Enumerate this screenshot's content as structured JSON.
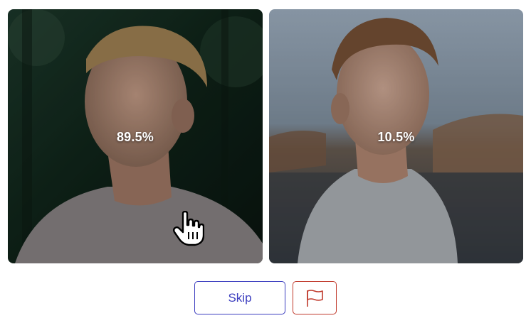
{
  "comparison": {
    "left": {
      "percentage_label": "89.5%",
      "share": 0.895
    },
    "right": {
      "percentage_label": "10.5%",
      "share": 0.105
    }
  },
  "actions": {
    "skip_label": "Skip",
    "flag_icon": "flag-icon"
  },
  "colors": {
    "skip_accent": "#3b3dbf",
    "flag_accent": "#c0392b"
  }
}
